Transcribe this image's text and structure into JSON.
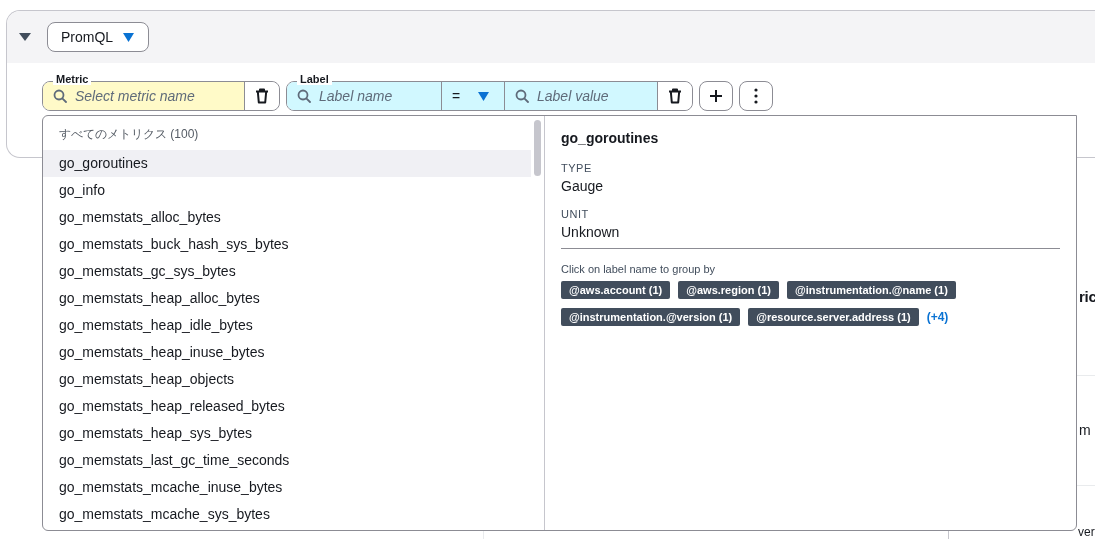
{
  "query_editor": {
    "expanded": true,
    "language": "PromQL"
  },
  "metric_field": {
    "label": "Metric",
    "placeholder": "Select metric name"
  },
  "label_filter": {
    "label": "Label",
    "name_placeholder": "Label name",
    "operator": "=",
    "value_placeholder": "Label value"
  },
  "dropdown": {
    "header": "すべてのメトリクス (100)",
    "items": [
      {
        "name": "go_goroutines",
        "selected": true
      },
      {
        "name": "go_info",
        "selected": false
      },
      {
        "name": "go_memstats_alloc_bytes",
        "selected": false
      },
      {
        "name": "go_memstats_buck_hash_sys_bytes",
        "selected": false
      },
      {
        "name": "go_memstats_gc_sys_bytes",
        "selected": false
      },
      {
        "name": "go_memstats_heap_alloc_bytes",
        "selected": false
      },
      {
        "name": "go_memstats_heap_idle_bytes",
        "selected": false
      },
      {
        "name": "go_memstats_heap_inuse_bytes",
        "selected": false
      },
      {
        "name": "go_memstats_heap_objects",
        "selected": false
      },
      {
        "name": "go_memstats_heap_released_bytes",
        "selected": false
      },
      {
        "name": "go_memstats_heap_sys_bytes",
        "selected": false
      },
      {
        "name": "go_memstats_last_gc_time_seconds",
        "selected": false
      },
      {
        "name": "go_memstats_mcache_inuse_bytes",
        "selected": false
      },
      {
        "name": "go_memstats_mcache_sys_bytes",
        "selected": false
      }
    ]
  },
  "details": {
    "title": "go_goroutines",
    "type_label": "TYPE",
    "type": "Gauge",
    "unit_label": "UNIT",
    "unit": "Unknown",
    "hint": "Click on label name to group by",
    "labels": [
      "@aws.account (1)",
      "@aws.region (1)",
      "@instrumentation.@name (1)",
      "@instrumentation.@version (1)",
      "@resource.server.address (1)"
    ],
    "more": "(+4)"
  },
  "background": {
    "fragments": [
      "ric",
      "m",
      "ver"
    ]
  }
}
